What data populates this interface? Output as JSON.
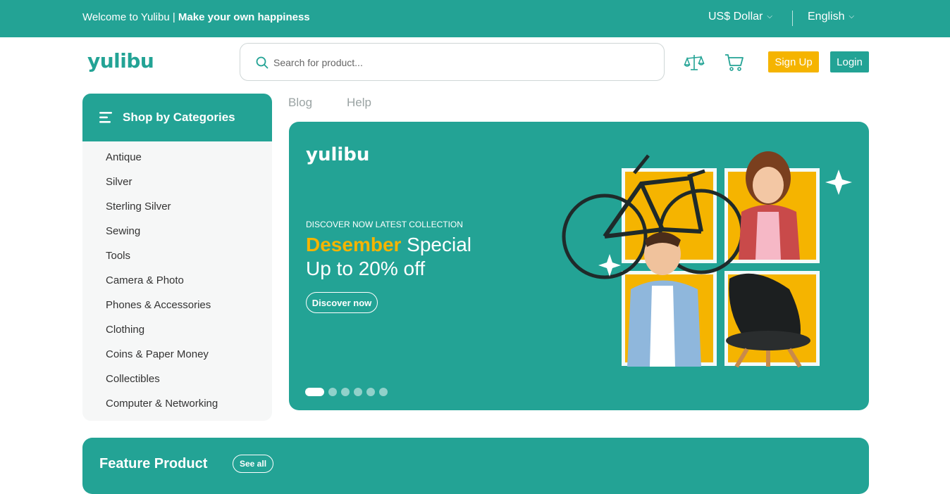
{
  "topbar": {
    "welcome_prefix": "Welcome to Yulibu | ",
    "welcome_bold": "Make your own happiness",
    "currency": "US$ Dollar",
    "language": "English"
  },
  "header": {
    "logo": "yulibu",
    "search_placeholder": "Search for product...",
    "compare_icon": "scale-icon",
    "cart_icon": "cart-icon",
    "signup_label": "Sign Up",
    "login_label": "Login"
  },
  "categories": {
    "title": "Shop by Categories",
    "items": [
      "Antique",
      "Silver",
      "Sterling Silver",
      "Sewing",
      "Tools",
      "Camera & Photo",
      "Phones & Accessories",
      "Clothing",
      "Coins & Paper Money",
      "Collectibles",
      "Computer & Networking"
    ]
  },
  "nav": {
    "links": [
      "Blog",
      "Help"
    ]
  },
  "banner": {
    "logo": "yulibu",
    "kicker": "DISCOVER NOW LATEST COLLECTION",
    "headline_highlight": "Desember",
    "headline_rest": " Special",
    "headline_line2": "Up to 20% off",
    "button_label": "Discover now",
    "slide_count": 6,
    "active_slide": 1
  },
  "feature": {
    "title": "Feature Product",
    "see_all": "See all"
  },
  "colors": {
    "brand": "#23a395",
    "accent": "#f5b400"
  }
}
